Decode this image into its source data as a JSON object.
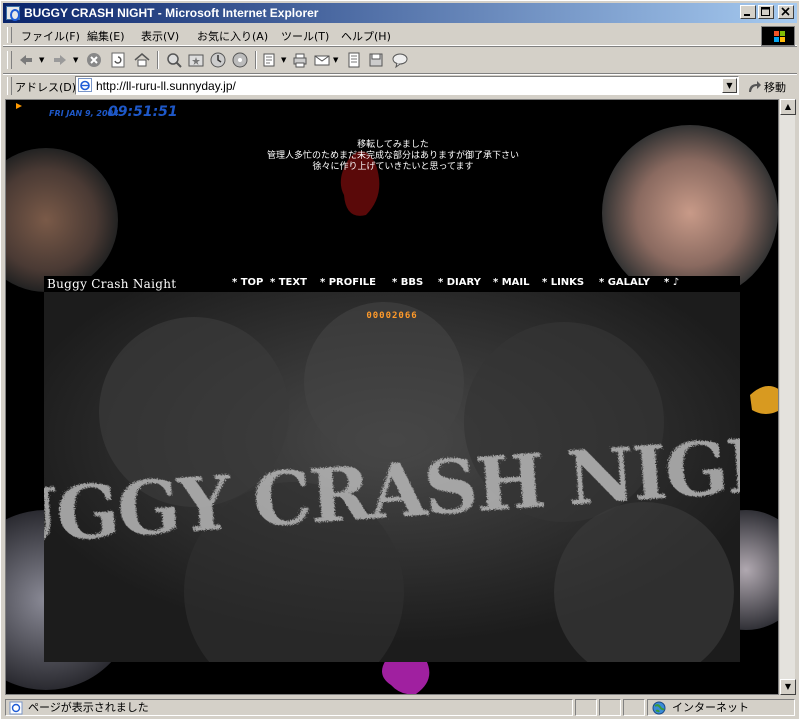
{
  "window": {
    "title": "BUGGY CRASH NIGHT - Microsoft Internet Explorer",
    "controls": {
      "minimize": "_",
      "maximize": "□",
      "close": "×"
    }
  },
  "menubar": {
    "items": [
      "ファイル(F)",
      "編集(E)",
      "表示(V)",
      "お気に入り(A)",
      "ツール(T)",
      "ヘルプ(H)"
    ]
  },
  "toolbar": {
    "buttons": [
      "back-icon",
      "forward-icon",
      "stop-icon",
      "refresh-icon",
      "home-icon",
      "search-icon",
      "favorites-icon",
      "history-icon",
      "media-icon",
      "edit-icon",
      "print-icon",
      "mail-icon",
      "document-icon",
      "save-icon",
      "messenger-icon"
    ]
  },
  "addressbar": {
    "label": "アドレス(D)",
    "url": "http://ll-ruru-ll.sunnyday.jp/",
    "go_label": "移動"
  },
  "page": {
    "date": "FRI JAN 9, 2004",
    "time": "09:51:51",
    "notice": [
      "移転してみました",
      "管理人多忙のためまだ未完成な部分はありますが御了承下さい",
      "徐々に作り上げていきたいと思ってます"
    ],
    "site_name": "Buggy Crash Naight",
    "nav": [
      "* TOP",
      "* TEXT",
      "* PROFILE",
      "* BBS",
      "* DIARY",
      "* MAIL",
      "* LINKS",
      "* GALALY",
      "* ♪"
    ],
    "counter": "00002066",
    "banner_text": "BUGGY CRASH NIGHT"
  },
  "statusbar": {
    "message": "ページが表示されました",
    "zone": "インターネット"
  },
  "colors": {
    "titlebar_start": "#0a246a",
    "titlebar_end": "#a6caf0",
    "page_bg": "#000000",
    "clock": "#1e58c8",
    "counter": "#ff9a2a",
    "notice_text": "#ffffff"
  }
}
